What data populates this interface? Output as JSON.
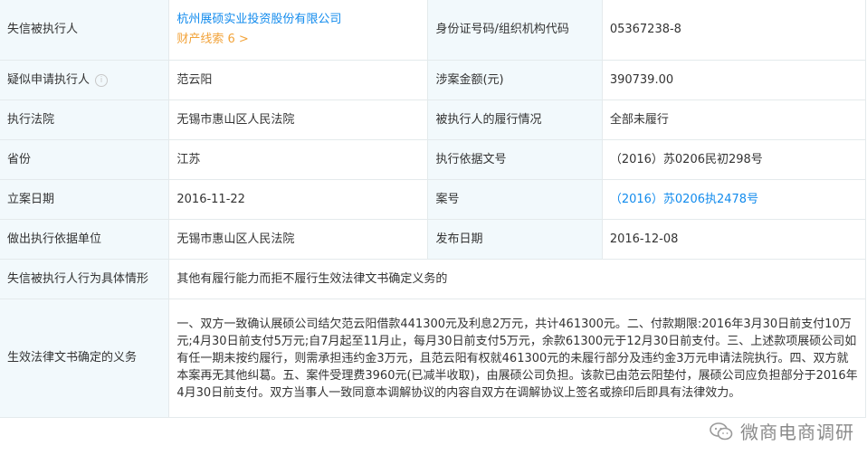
{
  "rows": {
    "r1": {
      "label_left": "失信被执行人",
      "company": "杭州展硕实业投资股份有限公司",
      "clue": "财产线索 6 >",
      "label_right": "身份证号码/组织机构代码",
      "value_right": "05367238-8"
    },
    "r2": {
      "label_left": "疑似申请执行人",
      "value_left": "范云阳",
      "label_right": "涉案金额(元)",
      "value_right": "390739.00"
    },
    "r3": {
      "label_left": "执行法院",
      "value_left": "无锡市惠山区人民法院",
      "label_right": "被执行人的履行情况",
      "value_right": "全部未履行"
    },
    "r4": {
      "label_left": "省份",
      "value_left": "江苏",
      "label_right": "执行依据文号",
      "value_right": "（2016）苏0206民初298号"
    },
    "r5": {
      "label_left": "立案日期",
      "value_left": "2016-11-22",
      "label_right": "案号",
      "value_right": "（2016）苏0206执2478号"
    },
    "r6": {
      "label_left": "做出执行依据单位",
      "value_left": "无锡市惠山区人民法院",
      "label_right": "发布日期",
      "value_right": "2016-12-08"
    },
    "r7": {
      "label": "失信被执行人行为具体情形",
      "value": "其他有履行能力而拒不履行生效法律文书确定义务的"
    },
    "r8": {
      "label": "生效法律文书确定的义务",
      "value": "一、双方一致确认展硕公司结欠范云阳借款441300元及利息2万元，共计461300元。二、付款期限:2016年3月30日前支付10万元;4月30日前支付5万元;自7月起至11月止，每月30日前支付5万元，余款61300元于12月30日前支付。三、上述款项展硕公司如有任一期未按约履行，则需承担违约金3万元，且范云阳有权就461300元的未履行部分及违约金3万元申请法院执行。四、双方就本案再无其他纠葛。五、案件受理费3960元(已减半收取)，由展硕公司负担。该款已由范云阳垫付，展硕公司应负担部分于2016年4月30日前支付。双方当事人一致同意本调解协议的内容自双方在调解协议上签名或捺印后即具有法律效力。"
    }
  },
  "watermark": {
    "text": "微商电商调研"
  },
  "colors": {
    "label_bg": "#f2f9fc",
    "border": "#e4eaec",
    "link": "#128bed",
    "clue": "#f2a33a"
  }
}
